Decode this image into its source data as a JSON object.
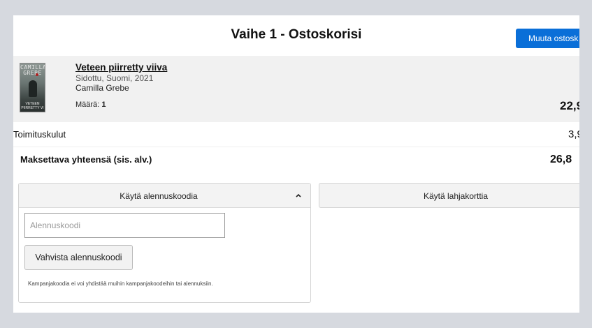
{
  "header": {
    "title": "Vaihe 1 - Ostoskorisi",
    "change_button": "Muuta ostosk"
  },
  "item": {
    "cover": {
      "author_line1": "CAMILLA",
      "author_line2": "GREBE",
      "title_line1": "VETEEN",
      "title_line2": "PIIRRETTY VI"
    },
    "title": "Veteen piirretty viiva",
    "meta": "Sidottu, Suomi, 2021",
    "author": "Camilla Grebe",
    "quantity_label": "Määrä:",
    "quantity_value": "1",
    "price": "22,9"
  },
  "shipping": {
    "label": "Toimituskulut",
    "value": "3,9"
  },
  "total": {
    "label": "Maksettava yhteensä (sis. alv.)",
    "value": "26,8"
  },
  "discount": {
    "header": "Käytä alennuskoodia",
    "placeholder": "Alennuskoodi",
    "confirm_button": "Vahvista alennuskoodi",
    "disclaimer": "Kampanjakoodia ei voi yhdistää muihin kampanjakoodeihin tai alennuksiin."
  },
  "giftcard": {
    "header": "Käytä lahjakorttia"
  },
  "icons": {
    "collapse": "chevron-up-icon"
  },
  "colors": {
    "primary_button": "#0a6fd8",
    "background": "#d6d9df"
  }
}
